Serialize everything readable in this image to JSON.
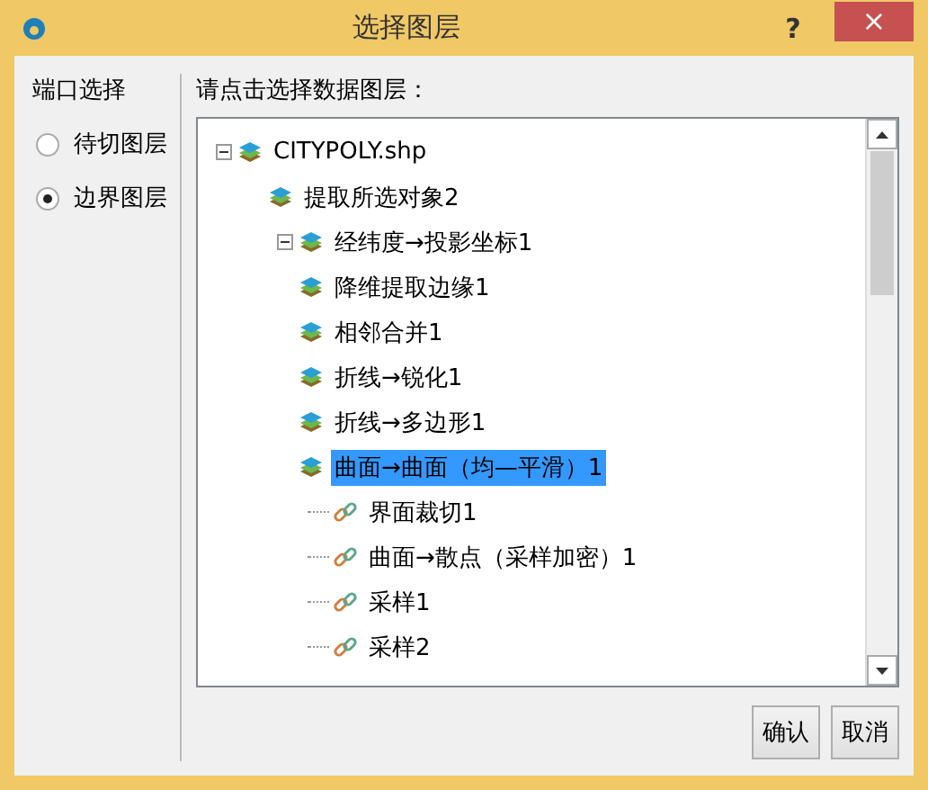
{
  "window": {
    "title": "选择图层",
    "help": "?",
    "close": "×"
  },
  "port_group": {
    "title": "端口选择",
    "options": [
      {
        "label": "待切图层",
        "selected": false
      },
      {
        "label": "边界图层",
        "selected": true
      }
    ]
  },
  "tree_prompt": "请点击选择数据图层：",
  "tree": [
    {
      "label": "CITYPOLY.shp",
      "kind": "layer",
      "expanded": true,
      "selected": false,
      "children": [
        {
          "label": "提取所选对象2",
          "kind": "layer",
          "selected": false,
          "children": [
            {
              "label": "经纬度→投影坐标1",
              "kind": "layer",
              "expanded": true,
              "selected": false
            },
            {
              "label": "降维提取边缘1",
              "kind": "layer",
              "selected": false
            },
            {
              "label": "相邻合并1",
              "kind": "layer",
              "selected": false
            },
            {
              "label": "折线→锐化1",
              "kind": "layer",
              "selected": false
            },
            {
              "label": "折线→多边形1",
              "kind": "layer",
              "selected": false
            },
            {
              "label": "曲面→曲面（均—平滑）1",
              "kind": "layer",
              "selected": true,
              "children": [
                {
                  "label": "界面裁切1",
                  "kind": "link",
                  "selected": false
                },
                {
                  "label": "曲面→散点（采样加密）1",
                  "kind": "link",
                  "selected": false
                },
                {
                  "label": "采样1",
                  "kind": "link",
                  "selected": false
                },
                {
                  "label": "采样2",
                  "kind": "link",
                  "selected": false
                }
              ]
            }
          ]
        }
      ]
    }
  ],
  "buttons": [
    "确认",
    "取消"
  ]
}
